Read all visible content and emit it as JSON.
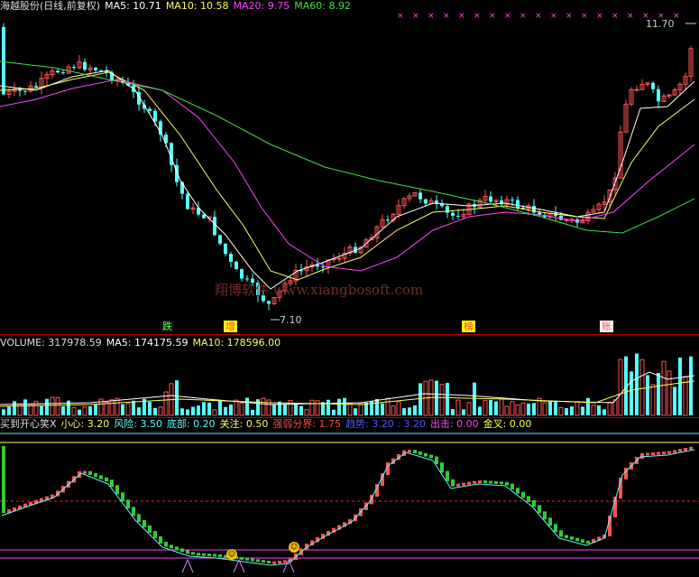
{
  "price_header": {
    "title": "海越股份(日线,前复权)",
    "ma5": "MA5: 10.71",
    "ma10": "MA10: 10.58",
    "ma20": "MA20: 9.75",
    "ma60": "MA60: 8.92"
  },
  "price_labels": {
    "high": "11.70",
    "low": "7.10"
  },
  "markers": {
    "m1": "跌",
    "m2": "增",
    "m3": "榜",
    "m4": "账"
  },
  "watermark": "翔博软件 www.xiangbosoft.com",
  "volume_header": {
    "volume": "VOLUME: 317978.59",
    "ma5": "MA5: 174175.59",
    "ma10": "MA10: 178596.00"
  },
  "indicator_header": {
    "name": "买到开心笑X",
    "xiaoxin": "小心: 3.20",
    "fengxian": "风险: 3.50",
    "dibu": "底部: 0.20",
    "guanzhu": "关注: 0.50",
    "qiangruo": "强弱分界: 1.75",
    "qushi": "趋势: 3.20 : 3.20",
    "chuji": "出击: 0.00",
    "jincha": "金叉: 0.00"
  },
  "emoji_icon": "smile-face-icon",
  "colors": {
    "up": "#ff5555",
    "down": "#55ffff",
    "ma5": "#ffffff",
    "ma10": "#ffff55",
    "ma20": "#ff44ff",
    "ma60": "#44dd44",
    "vol_ma5": "#ffffff",
    "vol_ma10": "#ffff55"
  }
}
